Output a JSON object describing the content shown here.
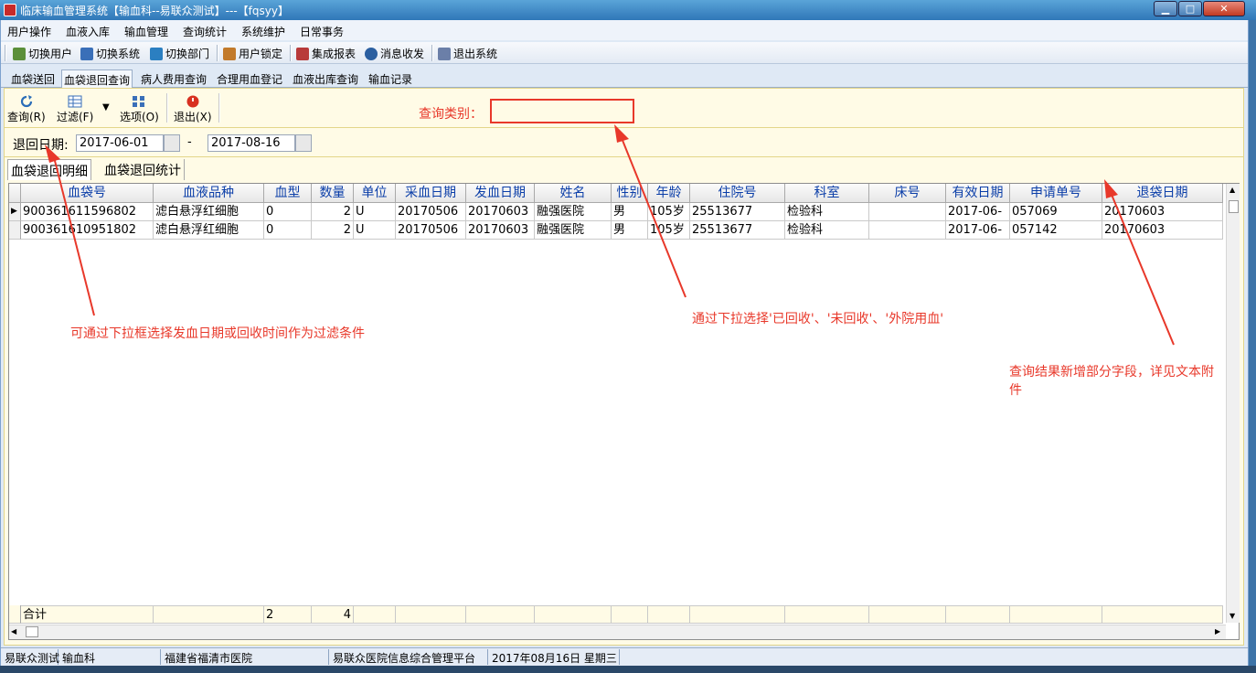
{
  "window": {
    "title": "临床输血管理系统【输血科--易联众测试】---【fqsyy】",
    "controls": {
      "minimize": "▁",
      "maximize": "□",
      "close": "✕"
    }
  },
  "menu": [
    "用户操作",
    "血液入库",
    "输血管理",
    "查询统计",
    "系统维护",
    "日常事务"
  ],
  "toolbar": [
    {
      "label": "切换用户",
      "icon": "users-icon",
      "color": "#5b8f3a"
    },
    {
      "label": "切换系统",
      "icon": "switch-system-icon",
      "color": "#3a6fb8"
    },
    {
      "label": "切换部门",
      "icon": "department-icon",
      "color": "#2b7fc1"
    },
    {
      "label": "用户锁定",
      "icon": "user-lock-icon",
      "color": "#c27a2b"
    },
    {
      "label": "集成报表",
      "icon": "report-icon",
      "color": "#b83a3a"
    },
    {
      "label": "消息收发",
      "icon": "info-icon",
      "color": "#2b5fa0"
    },
    {
      "label": "退出系统",
      "icon": "exit-door-icon",
      "color": "#6b7fa8"
    }
  ],
  "tabs": [
    "血袋送回",
    "血袋退回查询",
    "病人费用查询",
    "合理用血登记",
    "血液出库查询",
    "输血记录"
  ],
  "active_tab": "血袋退回查询",
  "panel_tools": [
    {
      "label": "查询(R)",
      "icon": "refresh-icon"
    },
    {
      "label": "过滤(F)",
      "icon": "filter-icon"
    },
    {
      "label": "选项(O)",
      "icon": "options-icon"
    },
    {
      "label": "退出(X)",
      "icon": "power-icon"
    }
  ],
  "filter_dropdown_arrow": "▼",
  "query_category": {
    "label": "查询类别：",
    "value": ""
  },
  "date_filter": {
    "label": "退回日期:",
    "from": "2017-06-01",
    "to": "2017-08-16",
    "separator": "-"
  },
  "subtabs": [
    "血袋退回明细",
    "血袋退回统计"
  ],
  "active_subtab": "血袋退回明细",
  "grid": {
    "columns": [
      "血袋号",
      "血液品种",
      "血型",
      "数量",
      "单位",
      "采血日期",
      "发血日期",
      "姓名",
      "性别",
      "年龄",
      "住院号",
      "科室",
      "床号",
      "有效日期",
      "申请单号",
      "退袋日期"
    ],
    "rows": [
      [
        "900361611596802",
        "滤白悬浮红细胞",
        "0",
        "2",
        "U",
        "20170506",
        "20170603",
        "融强医院",
        "男",
        "105岁",
        "25513677",
        "检验科",
        "",
        "2017-06-",
        "057069",
        "20170603"
      ],
      [
        "900361610951802",
        "滤白悬浮红细胞",
        "0",
        "2",
        "U",
        "20170506",
        "20170603",
        "融强医院",
        "男",
        "105岁",
        "25513677",
        "检验科",
        "",
        "2017-06-",
        "057142",
        "20170603"
      ]
    ],
    "row_marker": "▶",
    "summary": [
      "合计",
      "",
      "2",
      "4",
      "",
      "",
      "",
      "",
      "",
      "",
      "",
      "",
      "",
      "",
      "",
      ""
    ]
  },
  "annotations": {
    "filter_note": "可通过下拉框选择发血日期或回收时间作为过滤条件",
    "category_note": "通过下拉选择'已回收'、'未回收'、'外院用血'",
    "fields_note_line1": "查询结果新增部分字段，详见文本附",
    "fields_note_line2": "件",
    "color": "#e8382a"
  },
  "status": [
    "易联众测试",
    "输血科",
    "福建省福清市医院",
    "易联众医院信息综合管理平台",
    "2017年08月16日  星期三"
  ]
}
